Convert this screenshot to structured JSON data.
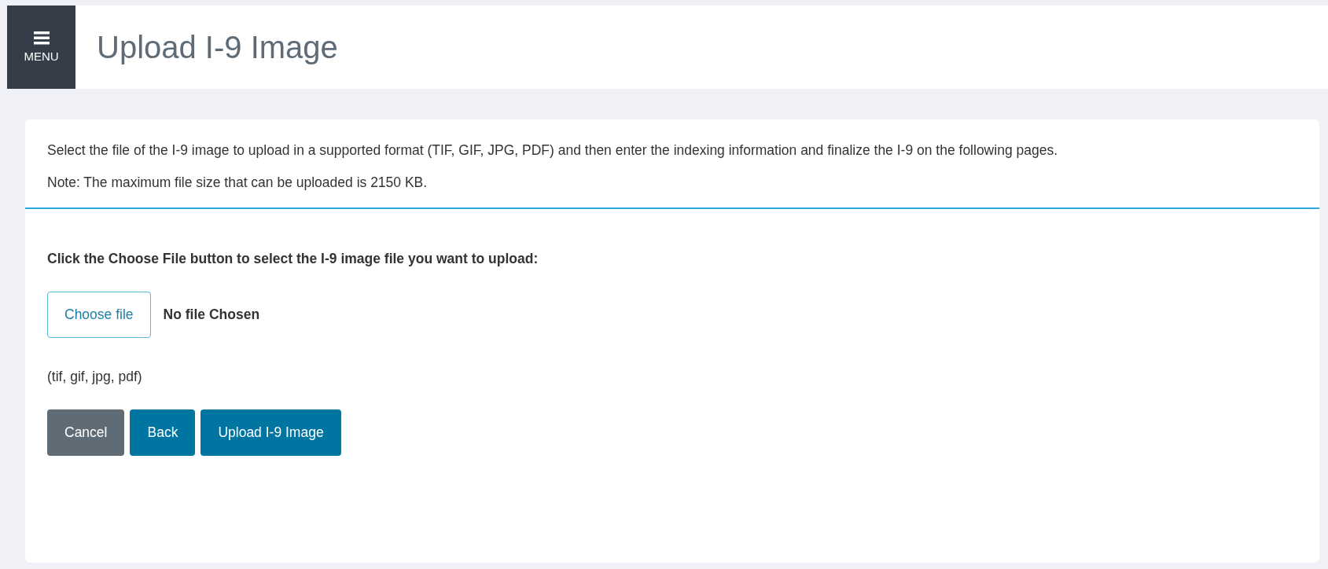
{
  "header": {
    "menu_label": "MENU",
    "title": "Upload I-9 Image"
  },
  "intro": {
    "description": "Select the file of the I-9 image to upload in a supported format (TIF, GIF, JPG, PDF) and then enter the indexing information and finalize the I-9 on the following pages.",
    "note": "Note: The maximum file size that can be uploaded is 2150 KB."
  },
  "upload": {
    "instruction": "Click the Choose File button to select the I-9 image file you want to upload:",
    "choose_button": "Choose file",
    "file_status": "No file Chosen",
    "formats": "(tif, gif, jpg, pdf)"
  },
  "buttons": [
    {
      "label": "Cancel",
      "kind": "secondary"
    },
    {
      "label": "Back",
      "kind": "primary"
    },
    {
      "label": "Upload I-9 Image",
      "kind": "primary"
    }
  ]
}
